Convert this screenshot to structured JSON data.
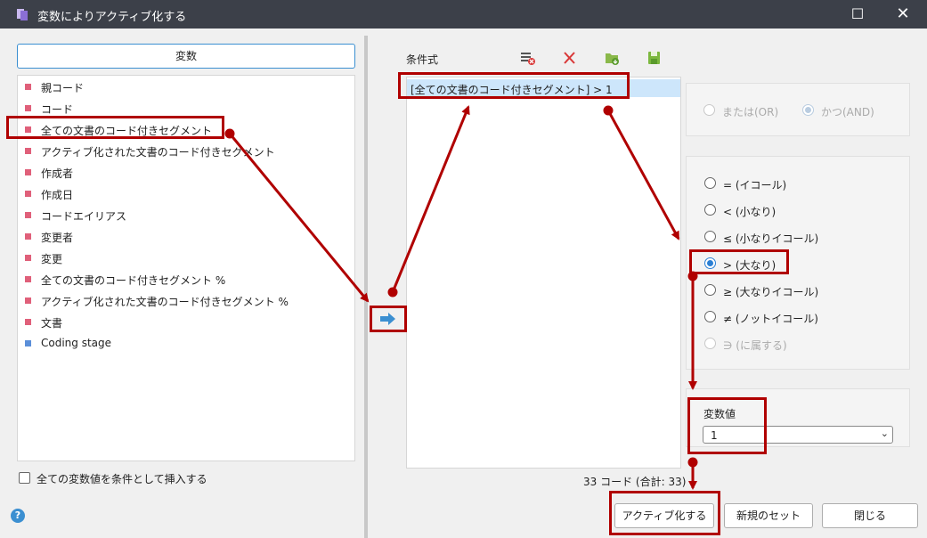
{
  "window": {
    "title": "変数によりアクティブ化する",
    "maximize_glyph": "☐",
    "close_glyph": "✕"
  },
  "variables": {
    "header": "変数",
    "items": [
      {
        "label": "親コード",
        "color": "#e0607a"
      },
      {
        "label": "コード",
        "color": "#e0607a"
      },
      {
        "label": "全ての文書のコード付きセグメント",
        "color": "#e0607a"
      },
      {
        "label": "アクティブ化された文書のコード付きセグメント",
        "color": "#e0607a"
      },
      {
        "label": "作成者",
        "color": "#e0607a"
      },
      {
        "label": "作成日",
        "color": "#e0607a"
      },
      {
        "label": "コードエイリアス",
        "color": "#e0607a"
      },
      {
        "label": "変更者",
        "color": "#e0607a"
      },
      {
        "label": "変更",
        "color": "#e0607a"
      },
      {
        "label": "全ての文書のコード付きセグメント %",
        "color": "#e0607a"
      },
      {
        "label": "アクティブ化された文書のコード付きセグメント %",
        "color": "#e0607a"
      },
      {
        "label": "文書",
        "color": "#e0607a"
      },
      {
        "label": "Coding stage",
        "color": "#5b8fd9"
      }
    ],
    "insert_all_label": "全ての変数値を条件として挿入する",
    "insert_all_checked": false
  },
  "conditions": {
    "label": "条件式",
    "rows": [
      "[全ての文書のコード付きセグメント] > 1"
    ],
    "count_text": "33 コード (合計: 33)"
  },
  "logic": {
    "options": [
      {
        "label": "または(OR)",
        "checked": false,
        "disabled": true
      },
      {
        "label": "かつ(AND)",
        "checked": true,
        "disabled": true
      }
    ]
  },
  "operators": {
    "options": [
      {
        "label": "= (イコール)",
        "checked": false,
        "disabled": false
      },
      {
        "label": "< (小なり)",
        "checked": false,
        "disabled": false
      },
      {
        "label": "≤ (小なりイコール)",
        "checked": false,
        "disabled": false
      },
      {
        "label": "> (大なり)",
        "checked": true,
        "disabled": false
      },
      {
        "label": "≥ (大なりイコール)",
        "checked": false,
        "disabled": false
      },
      {
        "label": "≠ (ノットイコール)",
        "checked": false,
        "disabled": false
      },
      {
        "label": "∋ (に属する)",
        "checked": false,
        "disabled": true
      }
    ]
  },
  "value": {
    "label": "変数値",
    "selected": "1"
  },
  "buttons": {
    "activate": "アクティブ化する",
    "new_set": "新規のセット",
    "close": "閉じる"
  },
  "help_glyph": "?",
  "colors": {
    "titlebar": "#3c4049",
    "accent": "#2a7fd4",
    "annotation": "#b00000",
    "selected_row": "#cde6fb"
  }
}
